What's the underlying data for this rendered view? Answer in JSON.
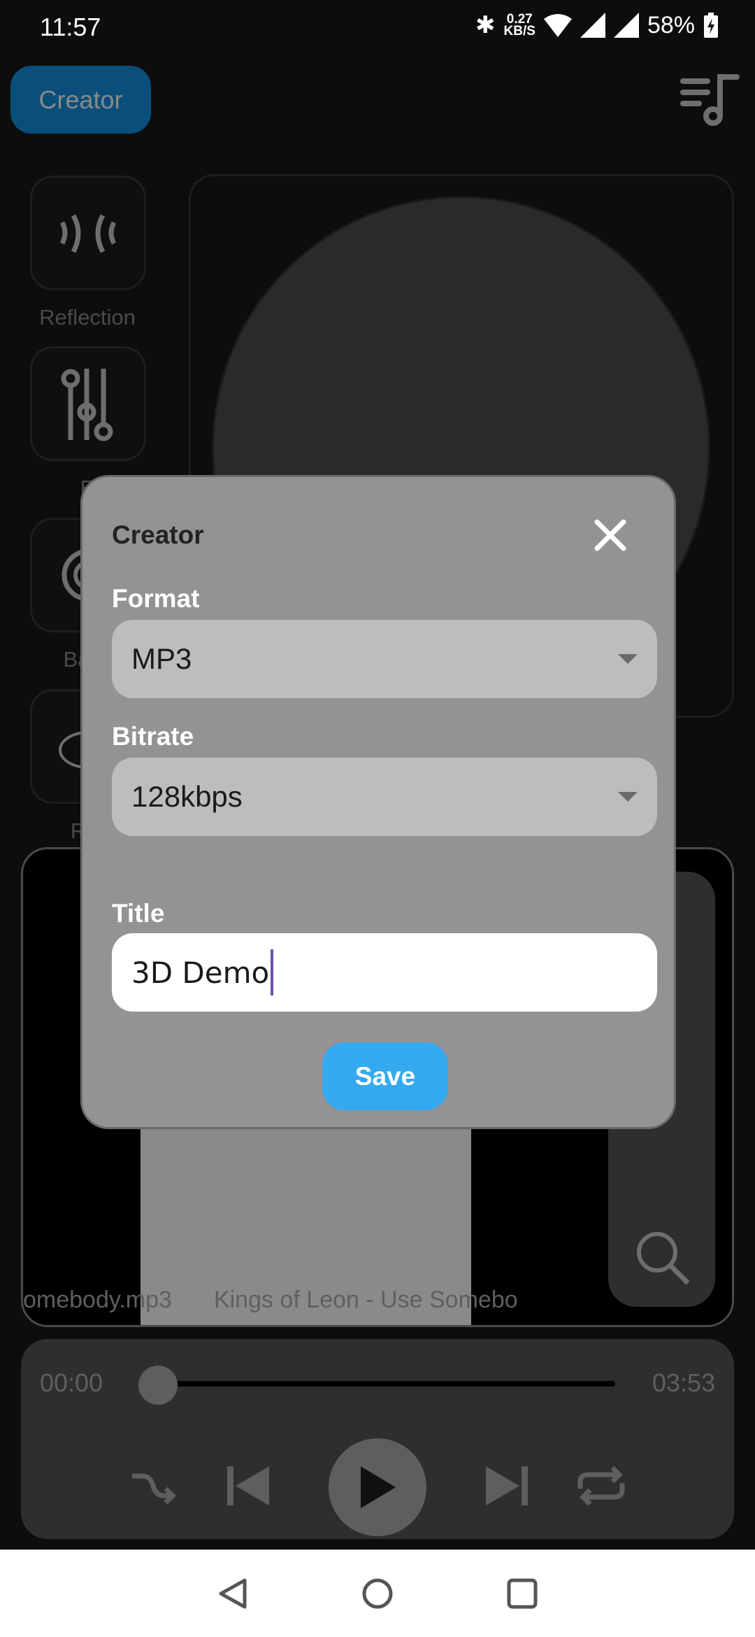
{
  "status_bar": {
    "time": "11:57",
    "net_speed_value": "0.27",
    "net_speed_unit": "KB/S",
    "battery": "58%"
  },
  "header": {
    "creator_button": "Creator",
    "playlist_icon": "playlist-music-icon"
  },
  "effects": [
    {
      "label": "Reflection",
      "icon": "reflection-icon"
    },
    {
      "label": "E",
      "icon": "equalizer-icon"
    },
    {
      "label": "Bass",
      "icon": "bass-speaker-icon"
    },
    {
      "label": "Rot",
      "icon": "rotation-icon"
    }
  ],
  "media": {
    "filename": "omebody.mp3",
    "track_title": "Kings of Leon - Use Somebo"
  },
  "player": {
    "elapsed": "00:00",
    "duration": "03:53",
    "progress": 0
  },
  "dialog": {
    "title": "Creator",
    "format_label": "Format",
    "format_value": "MP3",
    "bitrate_label": "Bitrate",
    "bitrate_value": "128kbps",
    "title_label": "Title",
    "title_value": "3D Demo",
    "save_label": "Save"
  },
  "colors": {
    "accent": "#35a9f0",
    "dialog_bg": "#939393",
    "cursor": "#6a4fb0"
  }
}
